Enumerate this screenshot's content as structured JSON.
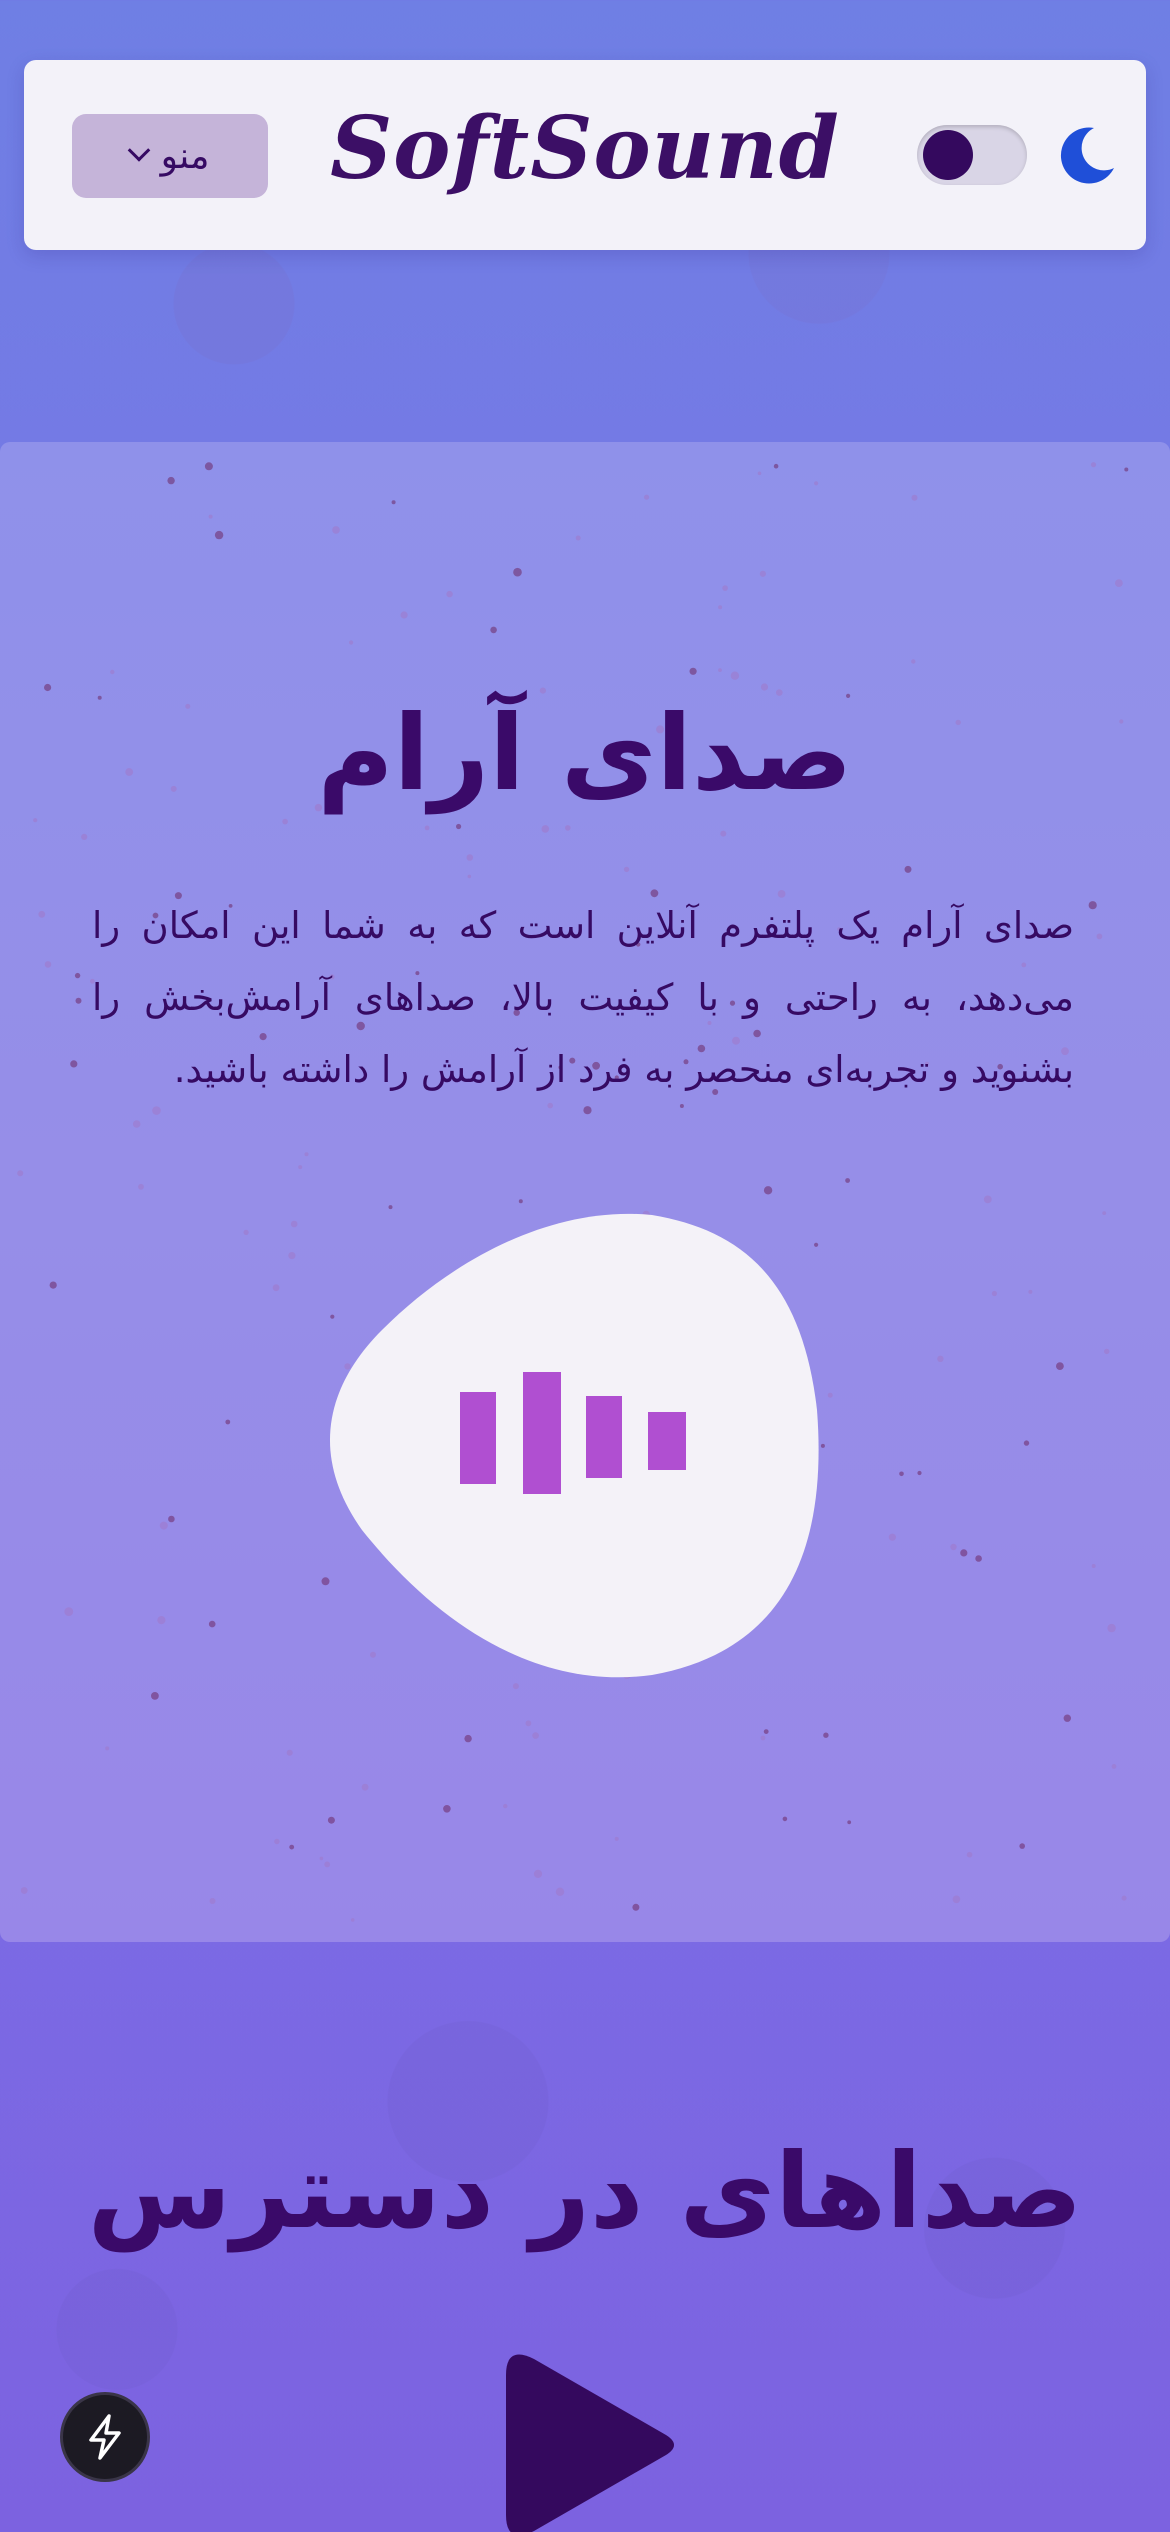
{
  "header": {
    "brand": "SoftSound",
    "menu_label": "منو"
  },
  "theme_toggle": {
    "state": "off"
  },
  "hero": {
    "title": "صدای آرام",
    "description": "صدای آرام یک پلتفرم آنلاین است که به شما این امکان را می‌دهد، به راحتی و با کیفیت بالا، صداهای آرامش‌بخش را بشنوید و تجربه‌ای منحصر به فرد از آرامش را داشته باشید."
  },
  "sections": {
    "available_sounds_title": "صداهای در دسترس"
  },
  "icons": {
    "menu_chevron": "chevron-down-icon",
    "theme": "moon-icon",
    "logo_mark": "sound-bars-icon",
    "play": "play-icon",
    "fab": "lightning-icon"
  },
  "colors": {
    "primary_text": "#360a63",
    "accent_bars": "#b04fd1",
    "moon": "#1f4fd8",
    "header_bg": "#f3f2f9",
    "menu_bg": "#c5b4d9"
  }
}
